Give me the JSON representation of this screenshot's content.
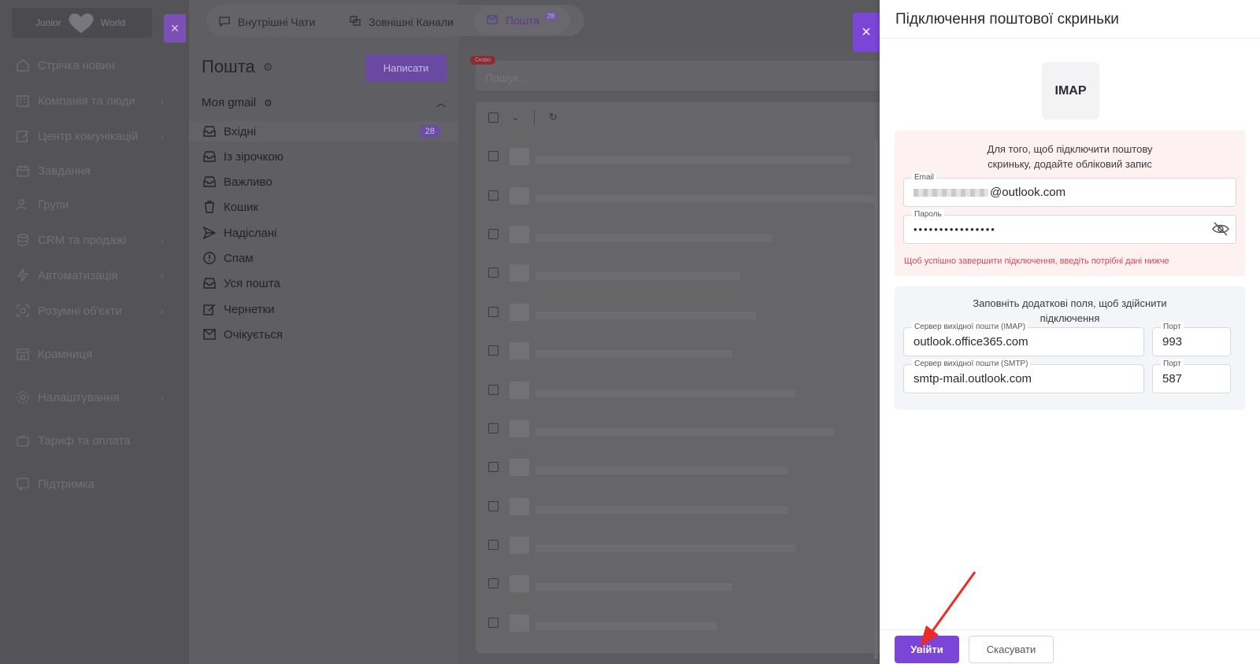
{
  "brand": {
    "name_left": "Junior",
    "name_right": "World"
  },
  "sidebar": {
    "items": [
      {
        "label": "Стрічка новин",
        "icon": "home-icon",
        "chevron": false
      },
      {
        "label": "Компанія та люди",
        "icon": "building-icon",
        "chevron": true
      },
      {
        "label": "Центр комунікацій",
        "icon": "edit-icon",
        "chevron": true
      },
      {
        "label": "Завдання",
        "icon": "calendar-icon",
        "chevron": false
      },
      {
        "label": "Групи",
        "icon": "users-icon",
        "chevron": false
      },
      {
        "label": "CRM та продажі",
        "icon": "database-icon",
        "chevron": true
      },
      {
        "label": "Автоматизація",
        "icon": "lightning-icon",
        "chevron": true
      },
      {
        "label": "Розумні об'єкти",
        "icon": "target-icon",
        "chevron": true
      },
      {
        "label": "Крамниця",
        "icon": "store-icon",
        "chevron": false
      },
      {
        "label": "Налаштування",
        "icon": "gear-icon",
        "chevron": true
      },
      {
        "label": "Тариф та оплата",
        "icon": "wallet-icon",
        "chevron": false
      },
      {
        "label": "Підтримка",
        "icon": "support-icon",
        "chevron": false
      }
    ]
  },
  "tabs": [
    {
      "label": "Внутрішні Чати",
      "icon": "chat-icon"
    },
    {
      "label": "Зовнішні Канали",
      "icon": "channels-icon"
    },
    {
      "label": "Пошта",
      "icon": "mail-icon",
      "badge": "28"
    }
  ],
  "mail": {
    "title": "Пошта",
    "compose_label": "Написати",
    "account": "Моя gmail",
    "folders": [
      {
        "label": "Вхідні",
        "icon": "inbox-icon",
        "count": "28"
      },
      {
        "label": "Із зірочкою",
        "icon": "inbox-icon"
      },
      {
        "label": "Важливо",
        "icon": "inbox-icon"
      },
      {
        "label": "Кошик",
        "icon": "trash-icon"
      },
      {
        "label": "Надіслані",
        "icon": "send-icon"
      },
      {
        "label": "Спам",
        "icon": "alert-icon"
      },
      {
        "label": "Уся пошта",
        "icon": "inbox-icon"
      },
      {
        "label": "Чернетки",
        "icon": "draft-icon"
      },
      {
        "label": "Очікується",
        "icon": "pending-mail-icon"
      }
    ],
    "search_placeholder": "Пошук...",
    "soon_badge": "Скоро"
  },
  "panel": {
    "title": "Підключення поштової скриньки",
    "provider": "IMAP",
    "alert_text": "Для того, щоб підключити поштову скриньку, додайте обліковий запис",
    "email_label": "Email",
    "email_value": "@outlook.com",
    "password_label": "Пароль",
    "password_value": "••••••••••••••••",
    "warning": "Щоб успішно завершити підключення, введіть потрібні дані нижче",
    "extra_text": "Заповніть додаткові поля, щоб здійснити підключення",
    "imap_label": "Сервер вихідної пошти (IMAP)",
    "imap_value": "outlook.office365.com",
    "imap_port_label": "Порт",
    "imap_port_value": "993",
    "smtp_label": "Сервер вихідної пошти (SMTP)",
    "smtp_value": "smtp-mail.outlook.com",
    "smtp_port_label": "Порт",
    "smtp_port_value": "587",
    "login_label": "Увійти",
    "cancel_label": "Скасувати"
  },
  "colors": {
    "accent": "#7b45d8",
    "warning": "#e0474c",
    "alert_bg": "#fdf1f2"
  }
}
